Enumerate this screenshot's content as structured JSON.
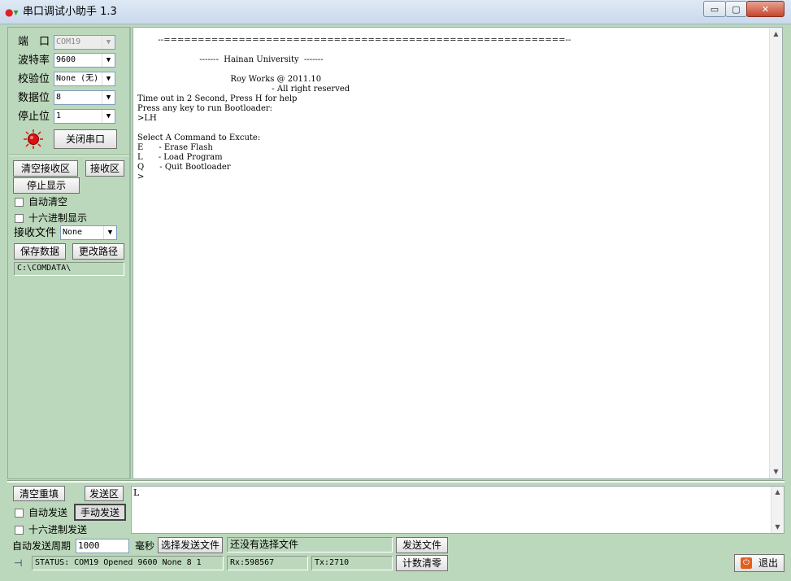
{
  "window": {
    "title": "串口调试小助手 1.3",
    "min_glyph": "▭",
    "max_glyph": "▢",
    "close_glyph": "✕"
  },
  "settings": {
    "port": {
      "label": "端　口",
      "value": "COM19"
    },
    "baud": {
      "label": "波特率",
      "value": "9600"
    },
    "parity": {
      "label": "校验位",
      "value": "None (无)"
    },
    "databits": {
      "label": "数据位",
      "value": "8"
    },
    "stopbits": {
      "label": "停止位",
      "value": "1"
    },
    "close_port_label": "关闭串口",
    "indicator_color": "#e01010"
  },
  "receive": {
    "clear_label": "清空接收区",
    "area_label": "接收区",
    "stop_label": "停止显示",
    "auto_clear_label": "自动清空",
    "hex_label": "十六进制显示",
    "file_label": "接收文件",
    "file_value": "None",
    "save_label": "保存数据",
    "change_path_label": "更改路径",
    "path": "C:\\COMDATA\\",
    "text": "        --===========================================================--\n\n                        -------  Hainan University  -------\n\n                                    Roy Works @ 2011.10\n                                                    - All right reserved\nTime out in 2 Second, Press H for help\nPress any key to run Bootloader:\n>LH\n\nSelect A Command to Excute:\nE      - Erase Flash\nL      - Load Program\nQ      - Quit Bootloader\n>"
  },
  "send": {
    "clear_label": "清空重填",
    "area_label": "发送区",
    "auto_label": "自动发送",
    "manual_label": "手动发送",
    "hex_label": "十六进制发送",
    "period_label": "自动发送周期",
    "period_value": "1000",
    "ms_label": "毫秒",
    "choose_file_label": "选择发送文件",
    "file_status": "还没有选择文件",
    "send_file_label": "发送文件",
    "reset_count_label": "计数清零",
    "text": "L"
  },
  "status": {
    "text": "STATUS: COM19 Opened 9600 None  8 1",
    "rx": "Rx:598567",
    "tx": "Tx:2710",
    "exit_label": "退出",
    "exit_color": "#e06020"
  }
}
